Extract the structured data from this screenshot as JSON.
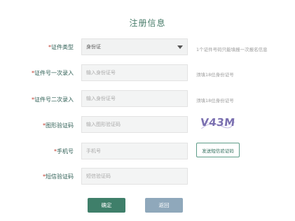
{
  "title": "注册信息",
  "rows": [
    {
      "label": "证件类型",
      "value": "身份证",
      "hint": "1个证件号码只能填报一次报名信息"
    },
    {
      "label": "证件号一次录入",
      "placeholder": "输入身份证号",
      "hint": "须填18位身份证号"
    },
    {
      "label": "证件号二次录入",
      "placeholder": "输入身份证号",
      "hint": "须填18位身份证号"
    },
    {
      "label": "图形验证码",
      "placeholder": "输入图形验证码",
      "captcha": "V43M"
    },
    {
      "label": "手机号",
      "placeholder": "手机号",
      "button": "发送短信验证码"
    },
    {
      "label": "短信验证码",
      "placeholder": "短信验证码"
    }
  ],
  "required_mark": "*",
  "buttons": {
    "confirm": "确定",
    "back": "返回"
  },
  "colors": {
    "accent": "#3f7f6a",
    "back": "#8fa8bb",
    "required": "#c0392b"
  }
}
